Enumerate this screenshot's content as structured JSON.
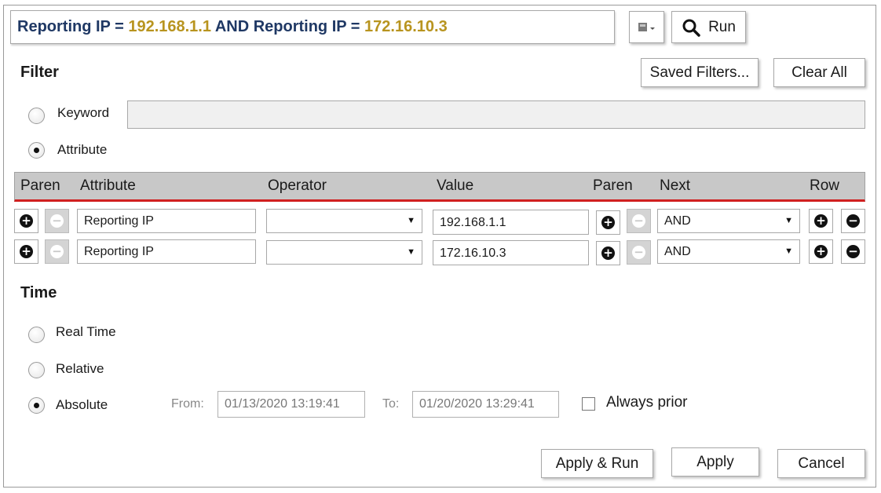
{
  "query": {
    "clause1_key": "Reporting IP =",
    "clause1_value": "192.168.1.1",
    "joiner_key": "AND Reporting IP =",
    "clause2_value": "172.16.10.3"
  },
  "toolbar": {
    "run_label": "Run"
  },
  "filter": {
    "title": "Filter",
    "saved_filters_label": "Saved Filters...",
    "clear_all_label": "Clear All",
    "keyword_label": "Keyword",
    "keyword_value": "",
    "attribute_label": "Attribute",
    "mode": "Attribute"
  },
  "table": {
    "headers": [
      "Paren",
      "Attribute",
      "Operator",
      "Value",
      "Paren",
      "Next",
      "Row"
    ],
    "rows": [
      {
        "attribute": "Reporting IP",
        "operator": "",
        "value": "192.168.1.1",
        "next": "AND"
      },
      {
        "attribute": "Reporting IP",
        "operator": "",
        "value": "172.16.10.3",
        "next": "AND"
      }
    ]
  },
  "time": {
    "title": "Time",
    "real_time_label": "Real Time",
    "relative_label": "Relative",
    "absolute_label": "Absolute",
    "selected": "Absolute",
    "from_label": "From:",
    "from_value": "01/13/2020 13:19:41",
    "to_label": "To:",
    "to_value": "01/20/2020 13:29:41",
    "always_prior_label": "Always prior",
    "always_prior_checked": false
  },
  "footer": {
    "apply_run_label": "Apply & Run",
    "apply_label": "Apply",
    "cancel_label": "Cancel"
  },
  "colors": {
    "query_key": "#1f3864",
    "query_value": "#b8941f",
    "header_accent": "#d02020"
  }
}
